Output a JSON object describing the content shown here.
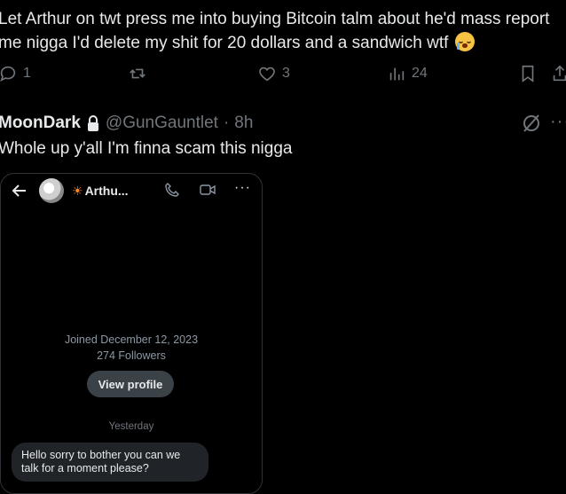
{
  "post": {
    "line1": "Let Arthur on twt press me into buying Bitcoin talm about he'd mass report",
    "line2": "me nigga I'd delete my shit for 20 dollars and a sandwich wtf",
    "emoji": "loudly-crying-face-emoji",
    "stats": {
      "replies": "1",
      "likes": "3",
      "views": "24"
    }
  },
  "reply": {
    "name": "MoonDark",
    "handle": "@GunGauntlet",
    "separator": "·",
    "time": "8h",
    "text": "Whole up y'all I'm finna scam this nigga"
  },
  "screenshot": {
    "chat_name": "Arthu...",
    "joined": "Joined December 12, 2023",
    "followers": "274 Followers",
    "view_profile": "View profile",
    "day_label": "Yesterday",
    "message": "Hello sorry to bother you can we talk for a moment please?"
  },
  "colors": {
    "background": "#000000",
    "text": "#e7e9ea",
    "muted": "#71767b",
    "button": "#3a4147"
  }
}
